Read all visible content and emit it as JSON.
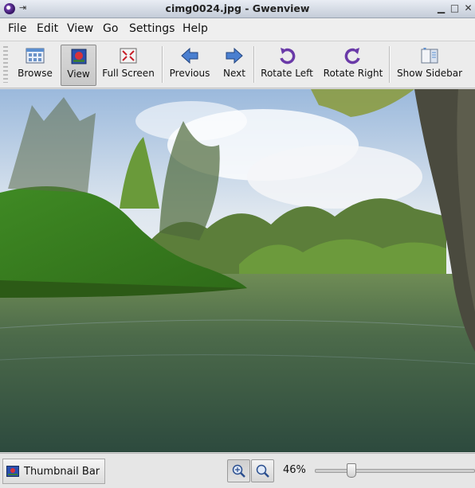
{
  "window": {
    "title": "cimg0024.jpg - Gwenview"
  },
  "menu": [
    "File",
    "Edit",
    "View",
    "Go",
    "Settings",
    "Help"
  ],
  "toolbar": {
    "browse": "Browse",
    "view": "View",
    "fullscreen": "Full Screen",
    "previous": "Previous",
    "next": "Next",
    "rotate_left": "Rotate Left",
    "rotate_right": "Rotate Right",
    "show_sidebar": "Show Sidebar"
  },
  "status": {
    "thumbnail_bar": "Thumbnail Bar",
    "zoom_label": "46%",
    "zoom_level": 0.46
  },
  "icons": {
    "browse": "browse-grid-icon",
    "view": "view-image-icon",
    "fullscreen": "fullscreen-icon",
    "previous": "arrow-left-icon",
    "next": "arrow-right-icon",
    "rotate_left": "rotate-left-icon",
    "rotate_right": "rotate-right-icon",
    "show_sidebar": "sidebar-icon"
  },
  "colors": {
    "accent": "#5b8fd0",
    "arrow": "#4a7fd0",
    "rotate": "#6a3aa8"
  }
}
